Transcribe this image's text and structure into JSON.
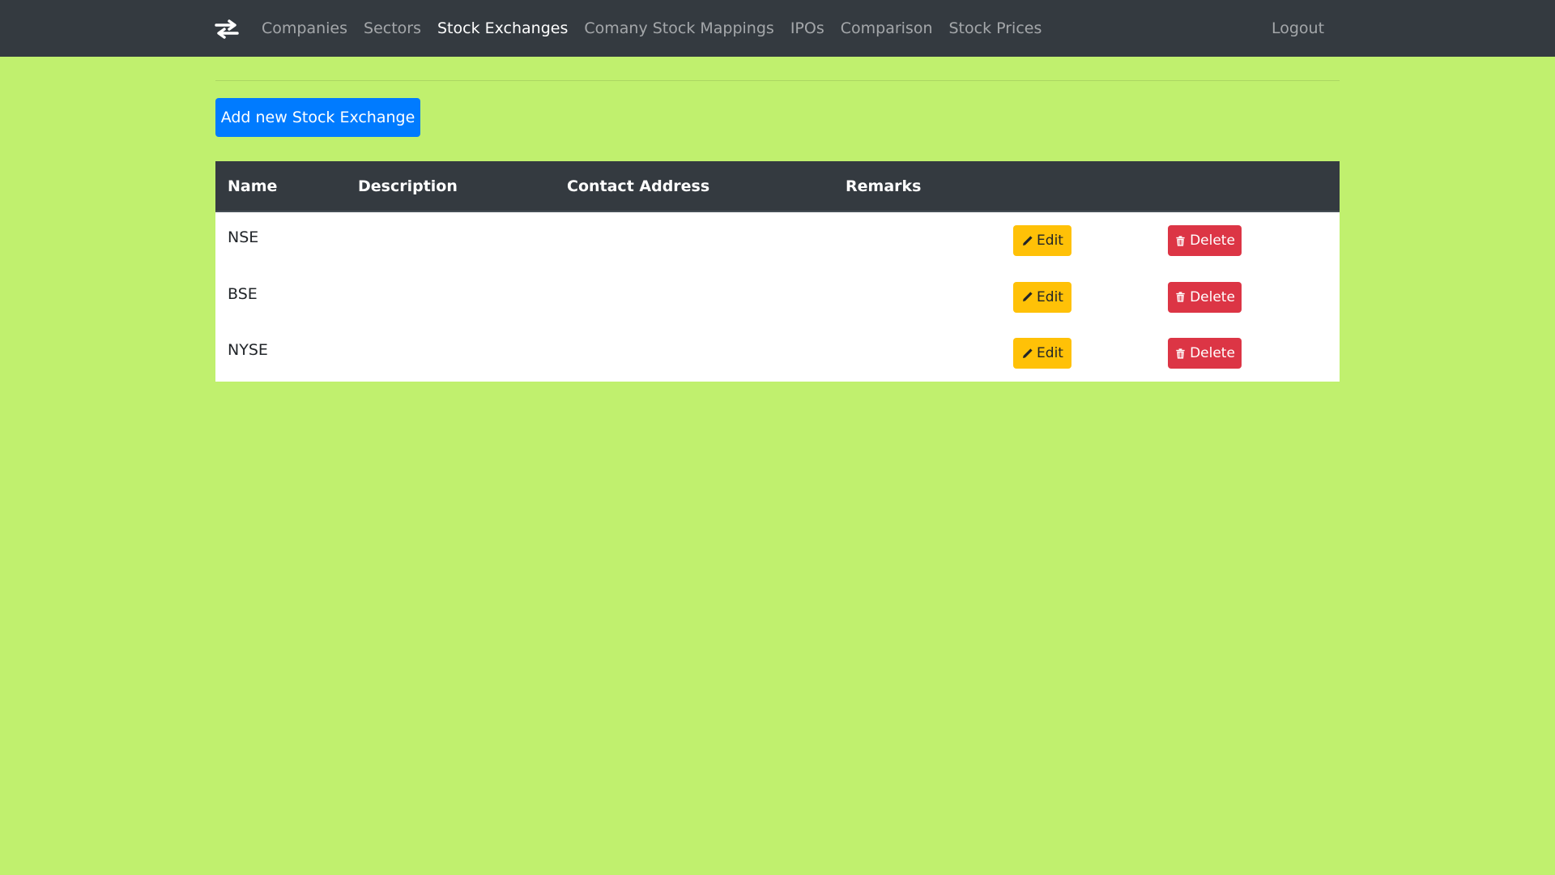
{
  "nav": {
    "brand_icon": "exchange-arrows-icon",
    "links": [
      {
        "label": "Companies"
      },
      {
        "label": "Sectors"
      },
      {
        "label": "Stock Exchanges",
        "active": true
      },
      {
        "label": "Comany Stock Mappings"
      },
      {
        "label": "IPOs"
      },
      {
        "label": "Comparison"
      },
      {
        "label": "Stock Prices"
      }
    ],
    "logout_label": "Logout"
  },
  "page": {
    "add_button_label": "Add new Stock Exchange"
  },
  "table": {
    "columns": [
      "Name",
      "Description",
      "Contact Address",
      "Remarks"
    ],
    "rows": [
      {
        "name": "NSE",
        "description": "",
        "contact_address": "",
        "remarks": ""
      },
      {
        "name": "BSE",
        "description": "",
        "contact_address": "",
        "remarks": ""
      },
      {
        "name": "NYSE",
        "description": "",
        "contact_address": "",
        "remarks": ""
      }
    ],
    "edit_label": "Edit",
    "delete_label": "Delete",
    "edit_icon": "pencil-icon",
    "delete_icon": "trash-icon"
  },
  "colors": {
    "page_background": "#c0f06e",
    "navbar": "#343a40",
    "primary": "#007bff",
    "warning": "#ffc107",
    "danger": "#dc3545"
  }
}
